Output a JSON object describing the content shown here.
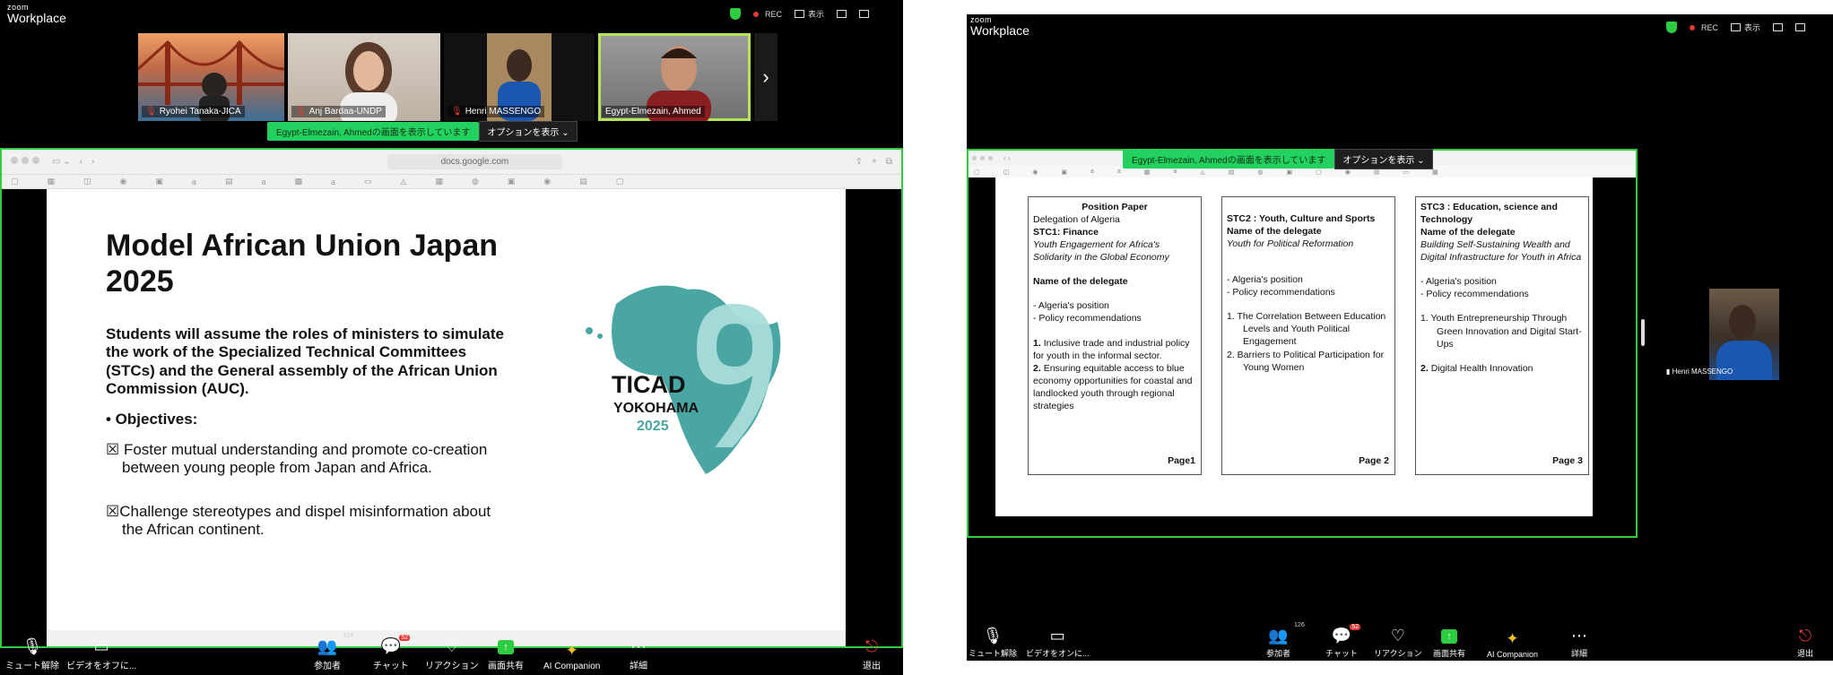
{
  "left": {
    "brand": {
      "zoom": "zoom",
      "workplace": "Workplace"
    },
    "rec": "REC",
    "display": "表示",
    "participants": [
      {
        "name": "Ryohei Tanaka-JICA"
      },
      {
        "name": "Anj Bardaa-UNDP"
      },
      {
        "name": "Henri MASSENGO"
      },
      {
        "name": "Egypt-Elmezain, Ahmed"
      }
    ],
    "share_banner": "Egypt-Elmezain, Ahmedの画面を表示しています",
    "options_label": "オプションを表示",
    "url": "docs.google.com",
    "slide": {
      "title": "Model African Union Japan 2025",
      "description": "Students will assume the roles of ministers to simulate the work of the Specialized Technical Committees (STCs) and the General assembly of the African Union Commission (AUC).",
      "objectives_label": "• Objectives:",
      "bullets": [
        "☒ Foster mutual understanding and promote co-creation between young people from Japan and Africa.",
        "☒Challenge stereotypes and dispel misinformation about the African continent."
      ],
      "logo": {
        "ticad": "TICAD",
        "city": "YOKOHAMA",
        "year": "2025",
        "numeral": "9"
      }
    },
    "toolbar": {
      "mute": "ミュート解除",
      "video": "ビデオをオフに...",
      "participants": "参加者",
      "participants_count": "124",
      "chat": "チャット",
      "chat_badge": "52",
      "reactions": "リアクション",
      "share": "画面共有",
      "ai": "AI Companion",
      "more": "詳細",
      "leave": "退出"
    }
  },
  "right": {
    "brand": {
      "zoom": "zoom",
      "workplace": "Workplace"
    },
    "rec": "REC",
    "display": "表示",
    "share_banner": "Egypt-Elmezain, Ahmedの画面を表示しています",
    "options_label": "オプションを表示",
    "doc": {
      "card1": {
        "heading": "Position Paper",
        "delegation": "Delegation of Algeria",
        "stc": "STC1: Finance",
        "topic": "Youth Engagement for Africa's Solidarity in the Global Economy",
        "name_label": "Name of the delegate",
        "position": "- Algeria's position",
        "policy": "- Policy recommendations",
        "item1_num": "1.",
        "item1": "Inclusive trade and industrial policy for youth in the informal sector.",
        "item2_num": "2.",
        "item2": "Ensuring equitable access to blue economy opportunities for coastal and landlocked youth through regional strategies",
        "page": "Page1"
      },
      "card2": {
        "stc": "STC2 : Youth, Culture and Sports",
        "name_label": "Name of the delegate",
        "topic": "Youth for Political Reformation",
        "position": "- Algeria's position",
        "policy": "- Policy recommendations",
        "item1": "1.    The Correlation Between Education Levels and Youth Political Engagement",
        "item2": "2.    Barriers to Political Participation for Young Women",
        "page": "Page 2"
      },
      "card3": {
        "stc": "STC3 : Education, science and Technology",
        "name_label": "Name of the delegate",
        "topic": "Building Self-Sustaining Wealth and Digital Infrastructure for Youth in Africa",
        "position": "- Algeria's position",
        "policy": "- Policy recommendations",
        "item1": "1.    Youth Entrepreneurship Through Green Innovation and Digital Start-Ups",
        "item2_num": "2.",
        "item2": "Digital Health Innovation",
        "page": "Page 3"
      }
    },
    "speaker_name": "Henri MASSENGO",
    "toolbar": {
      "mute": "ミュート解除",
      "video": "ビデオをオンに...",
      "participants": "参加者",
      "participants_count": "126",
      "chat": "チャット",
      "chat_badge": "52",
      "reactions": "リアクション",
      "share": "画面共有",
      "ai": "AI Companion",
      "more": "詳細",
      "leave": "退出"
    }
  },
  "colors": {
    "zoom_green": "#2ecc40",
    "ticad_teal": "#4aa6a3",
    "ticad_light": "#a8dcda"
  }
}
